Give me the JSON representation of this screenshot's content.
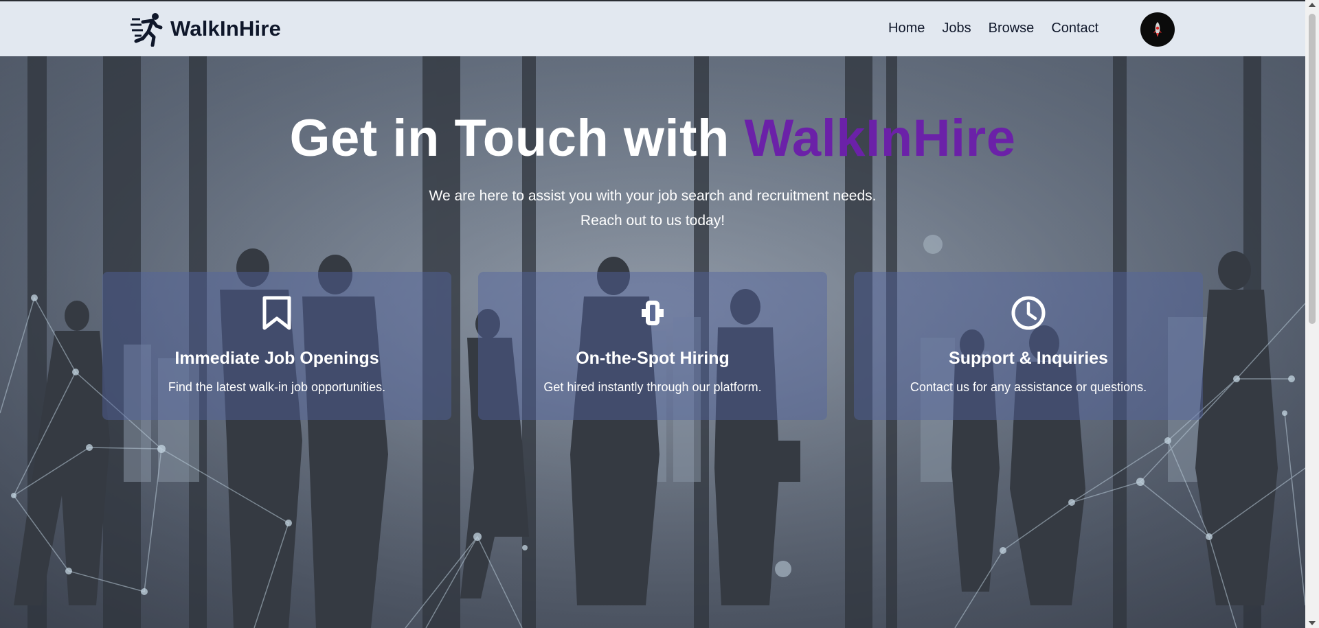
{
  "navbar": {
    "brand_name": "WalkInHire",
    "links": [
      "Home",
      "Jobs",
      "Browse",
      "Contact"
    ]
  },
  "hero": {
    "headline_main": "Get in Touch with ",
    "headline_accent": "WalkInHire",
    "subtitle_line1": "We are here to assist you with your job search and recruitment needs.",
    "subtitle_line2": "Reach out to us today!"
  },
  "cards": [
    {
      "icon": "bookmark-icon",
      "title": "Immediate Job Openings",
      "desc": "Find the latest walk-in job opportunities."
    },
    {
      "icon": "handshake-icon",
      "title": "On-the-Spot Hiring",
      "desc": "Get hired instantly through our platform."
    },
    {
      "icon": "clock-icon",
      "title": "Support & Inquiries",
      "desc": "Contact us for any assistance or questions."
    }
  ],
  "colors": {
    "accent": "#6b21a8",
    "navbar_bg": "#e2e8f0",
    "card_bg": "rgba(82,100,160,0.45)"
  }
}
